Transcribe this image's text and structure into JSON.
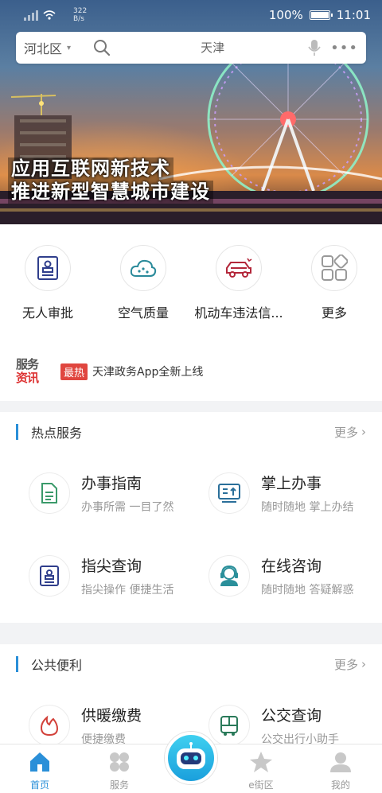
{
  "status_bar": {
    "network_speed": "322",
    "network_unit": "B/s",
    "battery": "100%",
    "time": "11:01"
  },
  "banner": {
    "line1": "应用互联网新技术",
    "line2": "推进新型智慧城市建设"
  },
  "search": {
    "district": "河北区",
    "placeholder": "天津"
  },
  "quick_services": [
    {
      "label": "无人审批",
      "icon": "stamp-icon"
    },
    {
      "label": "空气质量",
      "icon": "cloud-icon"
    },
    {
      "label": "机动车违法信...",
      "icon": "car-icon"
    },
    {
      "label": "更多",
      "icon": "grid-icon"
    }
  ],
  "news": {
    "logo_line1": "服务",
    "logo_line2": "资讯",
    "badge": "最热",
    "headline": "天津政务App全新上线"
  },
  "hot_services": {
    "title": "热点服务",
    "more": "更多",
    "items": [
      {
        "title": "办事指南",
        "subtitle": "办事所需 一目了然",
        "icon": "document-icon"
      },
      {
        "title": "掌上办事",
        "subtitle": "随时随地 掌上办结",
        "icon": "upload-screen-icon"
      },
      {
        "title": "指尖查询",
        "subtitle": "指尖操作 便捷生活",
        "icon": "stamp-icon"
      },
      {
        "title": "在线咨询",
        "subtitle": "随时随地 答疑解惑",
        "icon": "support-agent-icon"
      }
    ]
  },
  "public_services": {
    "title": "公共便利",
    "more": "更多",
    "items": [
      {
        "title": "供暖缴费",
        "subtitle": "便捷缴费",
        "icon": "flame-icon"
      },
      {
        "title": "公交查询",
        "subtitle": "公交出行小助手",
        "icon": "bus-icon"
      }
    ]
  },
  "tab_bar": [
    {
      "label": "首页",
      "icon": "home-icon",
      "active": true
    },
    {
      "label": "服务",
      "icon": "clover-icon",
      "active": false
    },
    {
      "label": "e街区",
      "icon": "star-icon",
      "active": false
    },
    {
      "label": "我的",
      "icon": "user-icon",
      "active": false
    }
  ],
  "colors": {
    "accent": "#2a8fd8",
    "hot_badge": "#e0463f",
    "section_bar": "#2a8fd8"
  }
}
